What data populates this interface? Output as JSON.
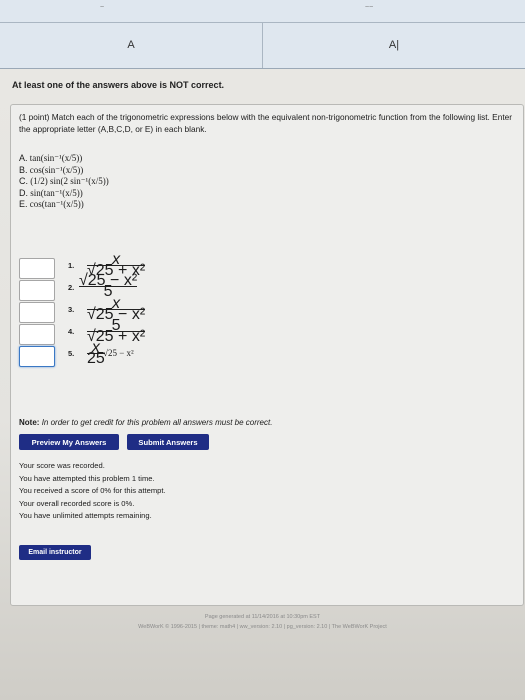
{
  "results_table": {
    "col1_label": "A",
    "col2_label": "A|"
  },
  "feedback_message": "At least one of the answers above is NOT correct.",
  "problem": {
    "points": "(1 point)",
    "prompt": "Match each of the trigonometric expressions below with the equivalent non-trigonometric function from the following list. Enter the appropriate letter (A,B,C,D, or E) in each blank.",
    "choices": [
      {
        "letter": "A.",
        "expr": "tan(sin⁻¹(x/5))"
      },
      {
        "letter": "B.",
        "expr": "cos(sin⁻¹(x/5))"
      },
      {
        "letter": "C.",
        "expr": "(1/2) sin(2 sin⁻¹(x/5))"
      },
      {
        "letter": "D.",
        "expr": "sin(tan⁻¹(x/5))"
      },
      {
        "letter": "E.",
        "expr": "cos(tan⁻¹(x/5))"
      }
    ],
    "items": [
      {
        "num": "1.",
        "value": "",
        "numerator": "x",
        "denominator": "√25 + x²"
      },
      {
        "num": "2.",
        "value": "",
        "numerator": "√25 − x²",
        "denominator": "5"
      },
      {
        "num": "3.",
        "value": "",
        "numerator": "x",
        "denominator": "√25 − x²"
      },
      {
        "num": "4.",
        "value": "",
        "numerator": "5",
        "denominator": "√25 + x²"
      },
      {
        "num": "5.",
        "value": "",
        "prefix_num": "x",
        "prefix_den": "25",
        "tail": "√25 − x²"
      }
    ],
    "note_label": "Note:",
    "note_text": "In order to get credit for this problem all answers must be correct."
  },
  "buttons": {
    "preview": "Preview My Answers",
    "submit": "Submit Answers",
    "email": "Email instructor"
  },
  "status_lines": [
    "Your score was recorded.",
    "You have attempted this problem 1 time.",
    "You received a score of 0% for this attempt.",
    "Your overall recorded score is 0%.",
    "You have unlimited attempts remaining."
  ],
  "footer": {
    "generated": "Page generated at 11/14/2016 at 10:30pm EST",
    "copyright": "WeBWorK © 1996-2015 | theme: math4 | ww_version: 2.10 | pg_version: 2.10 | The WeBWorK Project"
  }
}
